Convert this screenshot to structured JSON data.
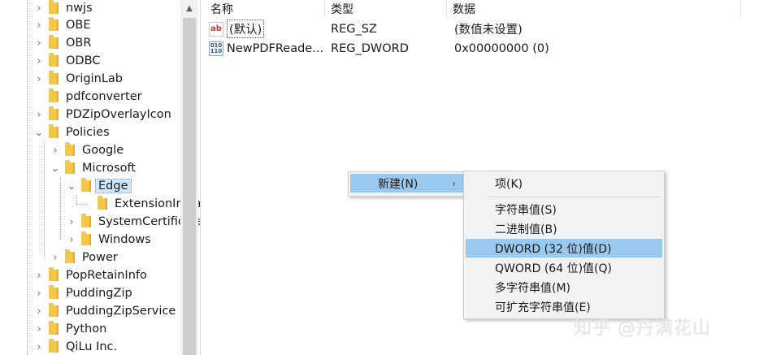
{
  "tree": {
    "items": [
      {
        "label": "nwjs",
        "expander": "›"
      },
      {
        "label": "OBE",
        "expander": "›"
      },
      {
        "label": "OBR",
        "expander": "›"
      },
      {
        "label": "ODBC",
        "expander": "›"
      },
      {
        "label": "OriginLab",
        "expander": "›"
      },
      {
        "label": "pdfconverter",
        "expander": ""
      },
      {
        "label": "PDZipOverlayIcon",
        "expander": "›"
      },
      {
        "label": "Policies",
        "expander": "⌄"
      },
      {
        "label": "Google",
        "expander": "›"
      },
      {
        "label": "Microsoft",
        "expander": "⌄"
      },
      {
        "label": "Edge",
        "expander": "⌄"
      },
      {
        "label": "ExtensionInstallForcelist",
        "expander": ""
      },
      {
        "label": "SystemCertificates",
        "expander": "›"
      },
      {
        "label": "Windows",
        "expander": "›"
      },
      {
        "label": "Power",
        "expander": "›"
      },
      {
        "label": "PopRetainInfo",
        "expander": "›"
      },
      {
        "label": "PuddingZip",
        "expander": "›"
      },
      {
        "label": "PuddingZipService",
        "expander": "›"
      },
      {
        "label": "Python",
        "expander": "›"
      },
      {
        "label": "QiLu Inc.",
        "expander": "›"
      }
    ]
  },
  "list": {
    "headers": {
      "name": "名称",
      "type": "类型",
      "data": "数据"
    },
    "rows": [
      {
        "icon": "ab",
        "name": "(默认)",
        "type": "REG_SZ",
        "data": "(数值未设置)"
      },
      {
        "icon": "bin",
        "name": "NewPDFReade...",
        "type": "REG_DWORD",
        "data": "0x00000000 (0)"
      }
    ]
  },
  "context_menu": {
    "new_label": "新建(N)",
    "arrow": "›"
  },
  "submenu": {
    "key": "项(K)",
    "string": "字符串值(S)",
    "binary": "二进制值(B)",
    "dword": "DWORD (32 位)值(D)",
    "qword": "QWORD (64 位)值(Q)",
    "multi_string": "多字符串值(M)",
    "expand_string": "可扩充字符串值(E)"
  },
  "watermark": "知乎 @丹满花山",
  "colors": {
    "highlight": "#99c9ef",
    "folder": "#f3c74a",
    "selection": "#cce8ff"
  }
}
